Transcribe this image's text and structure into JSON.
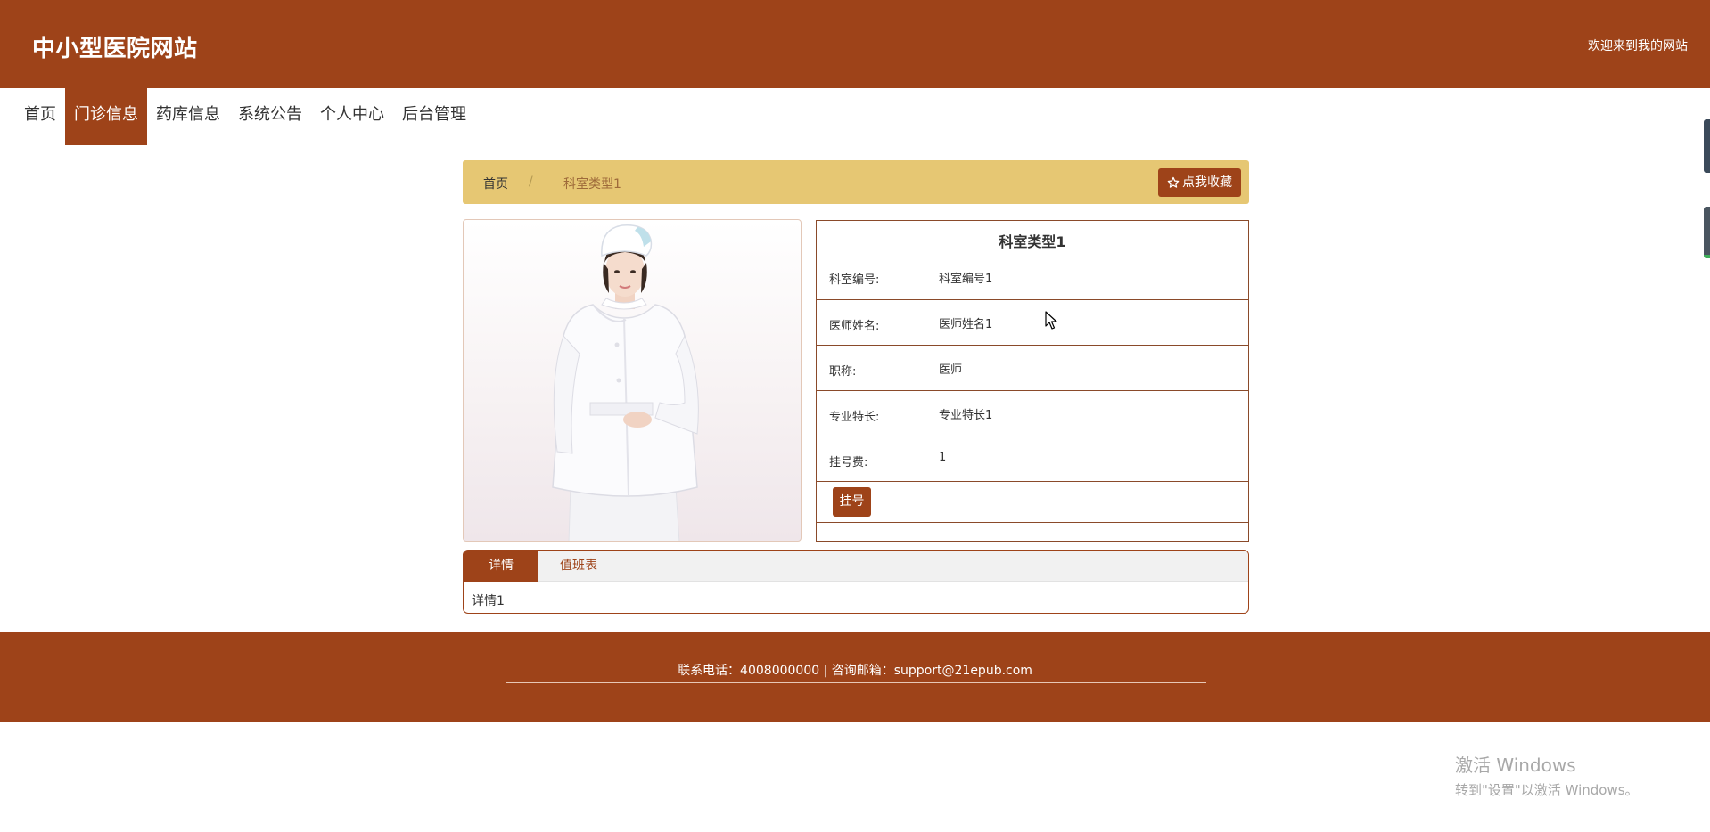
{
  "header": {
    "site_title": "中小型医院网站",
    "welcome": "欢迎来到我的网站"
  },
  "nav": {
    "items": [
      {
        "label": "首页"
      },
      {
        "label": "门诊信息"
      },
      {
        "label": "药库信息"
      },
      {
        "label": "系统公告"
      },
      {
        "label": "个人中心"
      },
      {
        "label": "后台管理"
      }
    ],
    "active_index": 1
  },
  "breadcrumb": {
    "home": "首页",
    "separator": "/",
    "current": "科室类型1",
    "favorite_label": "点我收藏",
    "favorite_icon": "star-outline-icon"
  },
  "detail": {
    "title": "科室类型1",
    "fields": [
      {
        "label": "科室编号:",
        "value": "科室编号1"
      },
      {
        "label": "医师姓名:",
        "value": "医师姓名1"
      },
      {
        "label": "职称:",
        "value": "医师"
      },
      {
        "label": "专业特长:",
        "value": "专业特长1"
      },
      {
        "label": "挂号费:",
        "value": "1"
      }
    ],
    "register_label": "挂号"
  },
  "tabs": {
    "items": [
      {
        "label": "详情"
      },
      {
        "label": "值班表"
      }
    ],
    "active_index": 0,
    "content": "详情1"
  },
  "footer": {
    "contact": "联系电话：4008000000 | 咨询邮箱：support@21epub.com"
  },
  "os_overlay": {
    "line1": "激活 Windows",
    "line2": "转到\"设置\"以激活 Windows。"
  },
  "colors": {
    "brand": "#9e4319",
    "breadcrumb_bg": "#e6c773"
  }
}
